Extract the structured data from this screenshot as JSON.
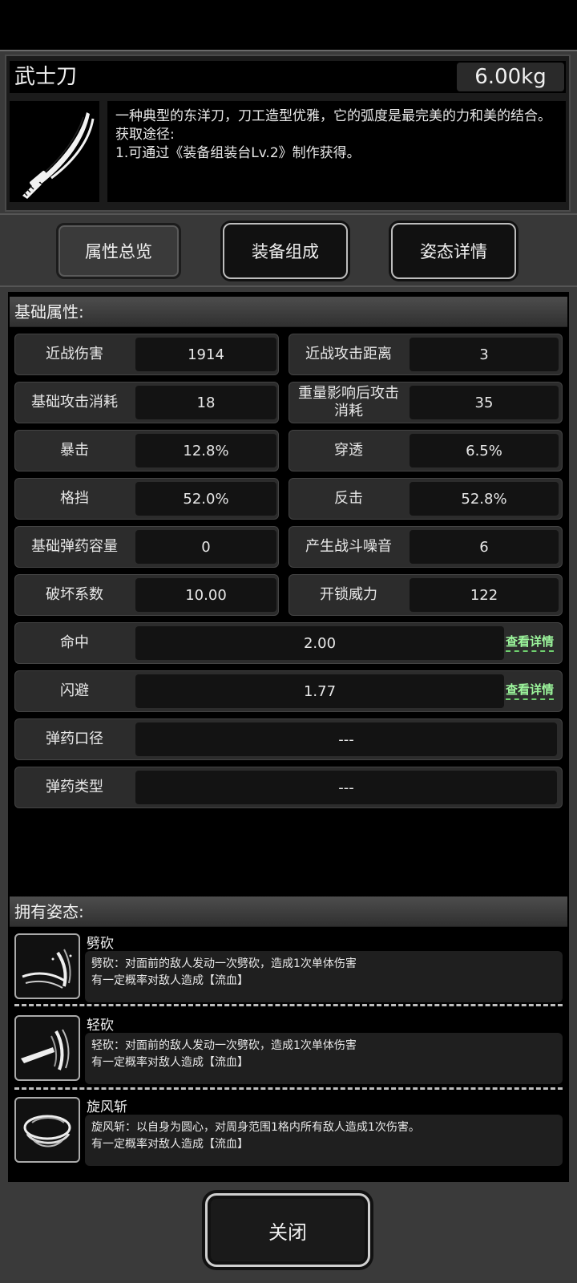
{
  "item": {
    "name": "武士刀",
    "weight": "6.00kg",
    "description": [
      "一种典型的东洋刀，刀工造型优雅，它的弧度是最完美的力和美的结合。",
      "获取途径:",
      "1.可通过《装备组装台Lv.2》制作获得。"
    ],
    "icon": "katana-icon"
  },
  "tabs": [
    {
      "label": "属性总览",
      "active": true
    },
    {
      "label": "装备组成",
      "active": false
    },
    {
      "label": "姿态详情",
      "active": false
    }
  ],
  "base_section": {
    "title": "基础属性:"
  },
  "stats": [
    {
      "label": "近战伤害",
      "value": "1914"
    },
    {
      "label": "近战攻击距离",
      "value": "3"
    },
    {
      "label": "基础攻击消耗",
      "value": "18"
    },
    {
      "label": "重量影响后攻击消耗",
      "value": "35"
    },
    {
      "label": "暴击",
      "value": "12.8%"
    },
    {
      "label": "穿透",
      "value": "6.5%"
    },
    {
      "label": "格挡",
      "value": "52.0%"
    },
    {
      "label": "反击",
      "value": "52.8%"
    },
    {
      "label": "基础弹药容量",
      "value": "0"
    },
    {
      "label": "产生战斗噪音",
      "value": "6"
    },
    {
      "label": "破坏系数",
      "value": "10.00"
    },
    {
      "label": "开锁威力",
      "value": "122"
    }
  ],
  "wide_stats": [
    {
      "label": "命中",
      "value": "2.00",
      "link": "查看详情"
    },
    {
      "label": "闪避",
      "value": "1.77",
      "link": "查看详情"
    },
    {
      "label": "弹药口径",
      "value": "---"
    },
    {
      "label": "弹药类型",
      "value": "---"
    }
  ],
  "stance_section": {
    "title": "拥有姿态:"
  },
  "stances": [
    {
      "name": "劈砍",
      "desc1": "劈砍：对面前的敌人发动一次劈砍，造成1次单体伤害",
      "desc2": "有一定概率对敌人造成【流血】",
      "icon": "slash-icon"
    },
    {
      "name": "轻砍",
      "desc1": "轻砍：对面前的敌人发动一次劈砍，造成1次单体伤害",
      "desc2": "有一定概率对敌人造成【流血】",
      "icon": "light-slash-icon"
    },
    {
      "name": "旋风斩",
      "desc1": "旋风斩：以自身为圆心，对周身范围1格内所有敌人造成1次伤害。",
      "desc2": "有一定概率对敌人造成【流血】",
      "icon": "whirlwind-icon"
    }
  ],
  "close_label": "关闭",
  "colors": {
    "link": "#9cf59c",
    "background": "#000000",
    "panel": "#3a3a3a"
  }
}
